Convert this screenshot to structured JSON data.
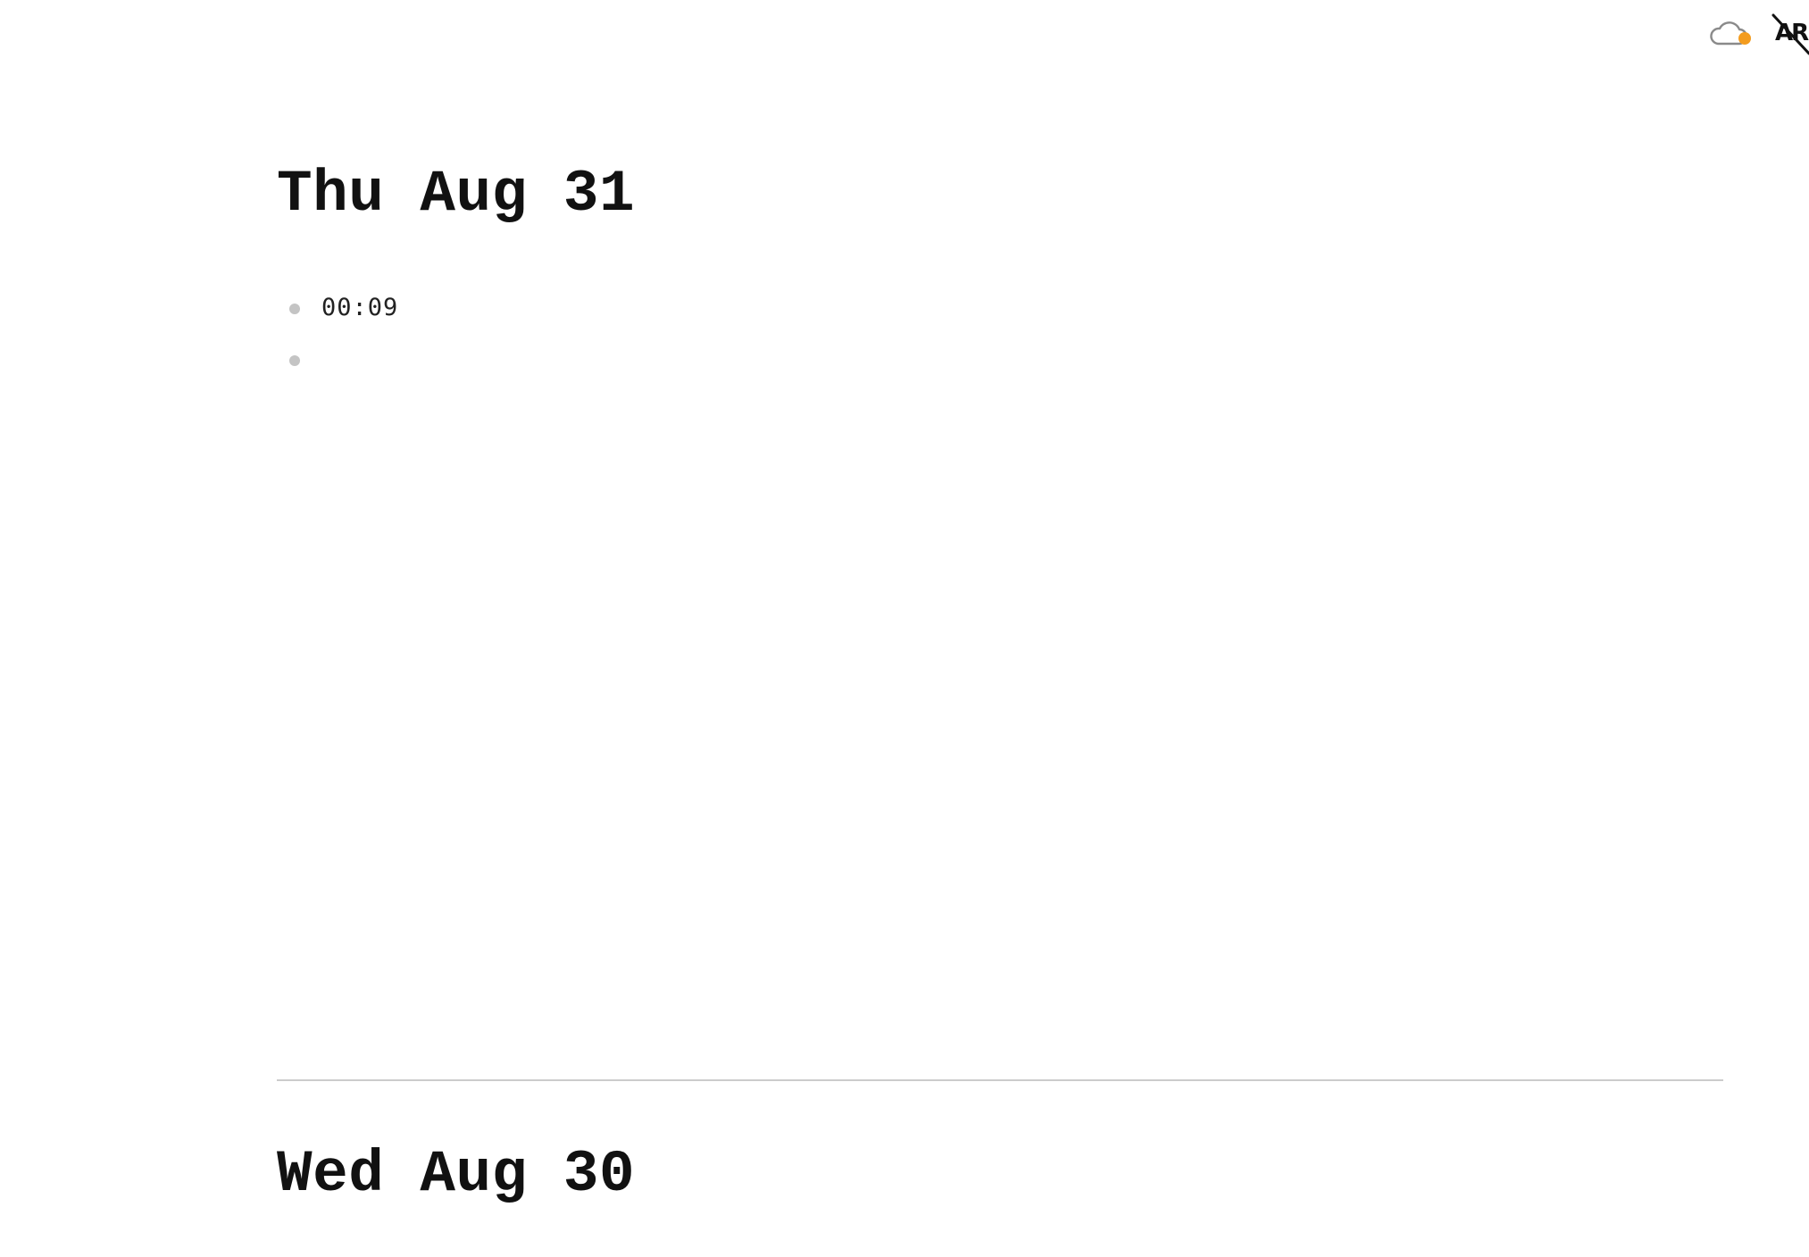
{
  "top_bar": {
    "sync_icon": "cloud-sync-icon",
    "sync_status_color": "#f39c1f",
    "font_icon": "font-toggle-icon",
    "font_icon_text": "AR"
  },
  "journal": {
    "days": [
      {
        "title": "Thu Aug 31",
        "blocks": [
          {
            "text": "00:09"
          },
          {
            "text": ""
          }
        ]
      },
      {
        "title": "Wed Aug 30",
        "blocks": []
      }
    ]
  },
  "colors": {
    "background": "#ffffff",
    "title_text": "#111111",
    "bullet": "#c4c4c4",
    "divider": "#cccccc",
    "sync_status": "#f39c1f"
  }
}
